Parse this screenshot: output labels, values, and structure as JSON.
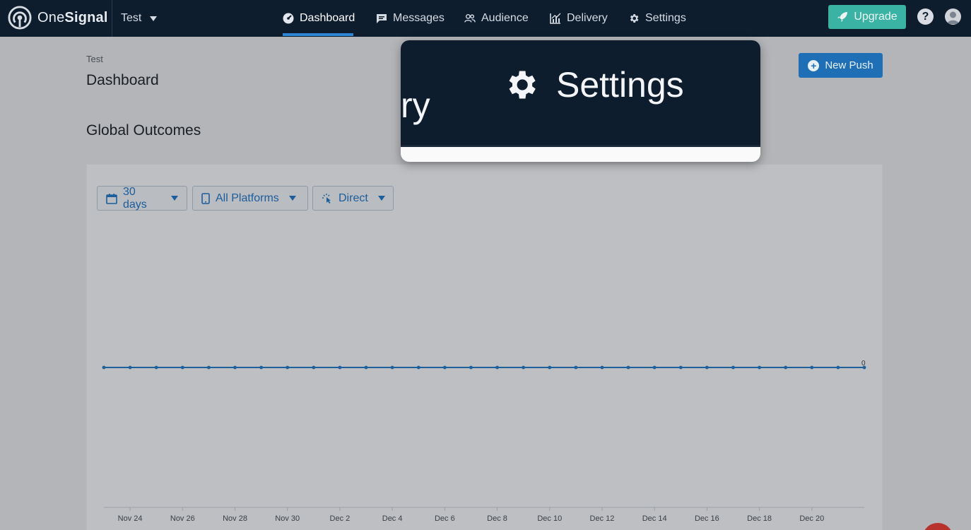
{
  "brand": {
    "name_light": "One",
    "name_bold": "Signal"
  },
  "app_switcher": {
    "label": "Test"
  },
  "nav": {
    "items": [
      {
        "label": "Dashboard",
        "icon": "dashboard-icon",
        "active": true
      },
      {
        "label": "Messages",
        "icon": "messages-icon",
        "active": false
      },
      {
        "label": "Audience",
        "icon": "audience-icon",
        "active": false
      },
      {
        "label": "Delivery",
        "icon": "delivery-icon",
        "active": false
      },
      {
        "label": "Settings",
        "icon": "gear-icon",
        "active": false
      }
    ],
    "upgrade_label": "Upgrade",
    "help_label": "?"
  },
  "page": {
    "breadcrumb": "Test",
    "title": "Dashboard",
    "new_push_label": "New Push",
    "section_title": "Global Outcomes"
  },
  "filters": {
    "range": "30 days",
    "platforms": "All Platforms",
    "attribution": "Direct"
  },
  "zoom_popover": {
    "fragment": "ry",
    "label": "Settings"
  },
  "colors": {
    "nav_bg": "#0d1d2e",
    "accent_blue": "#1f6fb7",
    "upgrade_teal": "#3ab3a4",
    "line": "#1f5f9c"
  },
  "chart_data": {
    "type": "line",
    "x": [
      "Nov 23",
      "Nov 24",
      "Nov 25",
      "Nov 26",
      "Nov 27",
      "Nov 28",
      "Nov 29",
      "Nov 30",
      "Dec 1",
      "Dec 2",
      "Dec 3",
      "Dec 4",
      "Dec 5",
      "Dec 6",
      "Dec 7",
      "Dec 8",
      "Dec 9",
      "Dec 10",
      "Dec 11",
      "Dec 12",
      "Dec 13",
      "Dec 14",
      "Dec 15",
      "Dec 16",
      "Dec 17",
      "Dec 18",
      "Dec 19",
      "Dec 20",
      "Dec 21",
      "Dec 22"
    ],
    "tick_labels": [
      "Nov 24",
      "Nov 26",
      "Nov 28",
      "Nov 30",
      "Dec 2",
      "Dec 4",
      "Dec 6",
      "Dec 8",
      "Dec 10",
      "Dec 12",
      "Dec 14",
      "Dec 16",
      "Dec 18",
      "Dec 20"
    ],
    "series": [
      {
        "values": [
          0,
          0,
          0,
          0,
          0,
          0,
          0,
          0,
          0,
          0,
          0,
          0,
          0,
          0,
          0,
          0,
          0,
          0,
          0,
          0,
          0,
          0,
          0,
          0,
          0,
          0,
          0,
          0,
          0,
          0
        ]
      }
    ],
    "last_value_label": "0",
    "grid": false
  }
}
